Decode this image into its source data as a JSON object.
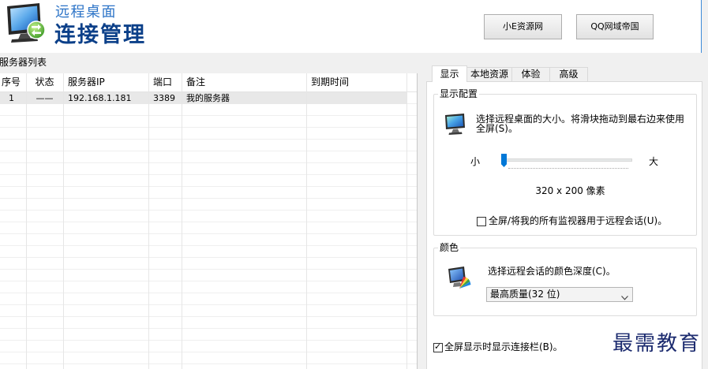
{
  "window": {
    "title_small": "远程桌面",
    "title_large": "连接管理"
  },
  "header_buttons": [
    {
      "label": "小E资源网"
    },
    {
      "label": "QQ网域帝国"
    }
  ],
  "server_list": {
    "group_label": "服务器列表",
    "columns": [
      "序号",
      "状态",
      "服务器IP",
      "端口",
      "备注",
      "到期时间"
    ],
    "rows": [
      {
        "index": "1",
        "status": "——",
        "ip": "192.168.1.181",
        "port": "3389",
        "note": "我的服务器"
      }
    ]
  },
  "tabs": [
    {
      "label": "显示",
      "selected": true
    },
    {
      "label": "本地资源",
      "selected": false
    },
    {
      "label": "体验",
      "selected": false
    },
    {
      "label": "高级",
      "selected": false
    }
  ],
  "display": {
    "group_label": "显示配置",
    "description": "选择远程桌面的大小。将滑块拖动到最右边来使用全屏(S)。",
    "slider_min_label": "小",
    "slider_max_label": "大",
    "slider_level": 0,
    "resolution_text": "320 x 200 像素",
    "multimon_checkbox": {
      "label": "全屏/将我的所有监视器用于远程会话(U)。",
      "checked": false
    }
  },
  "color": {
    "group_label": "颜色",
    "description": "选择远程会话的颜色深度(C)。",
    "depth_select": {
      "value": "最高质量(32 位)"
    }
  },
  "connection_bar_checkbox": {
    "label": "全屏显示时显示连接栏(B)。",
    "checked": true
  },
  "watermark": "最需教育",
  "icons": {
    "app": "remote-desktop-icon",
    "display": "monitor-icon",
    "color": "color-palette-icon",
    "select_arrow": "chevron-down-icon"
  },
  "colors": {
    "title_small": "#2b73c7",
    "title_large": "#0c4089",
    "slider_thumb": "#0078d7",
    "row_selected": "#e8e8e8",
    "watermark": "#1c2b6f"
  }
}
